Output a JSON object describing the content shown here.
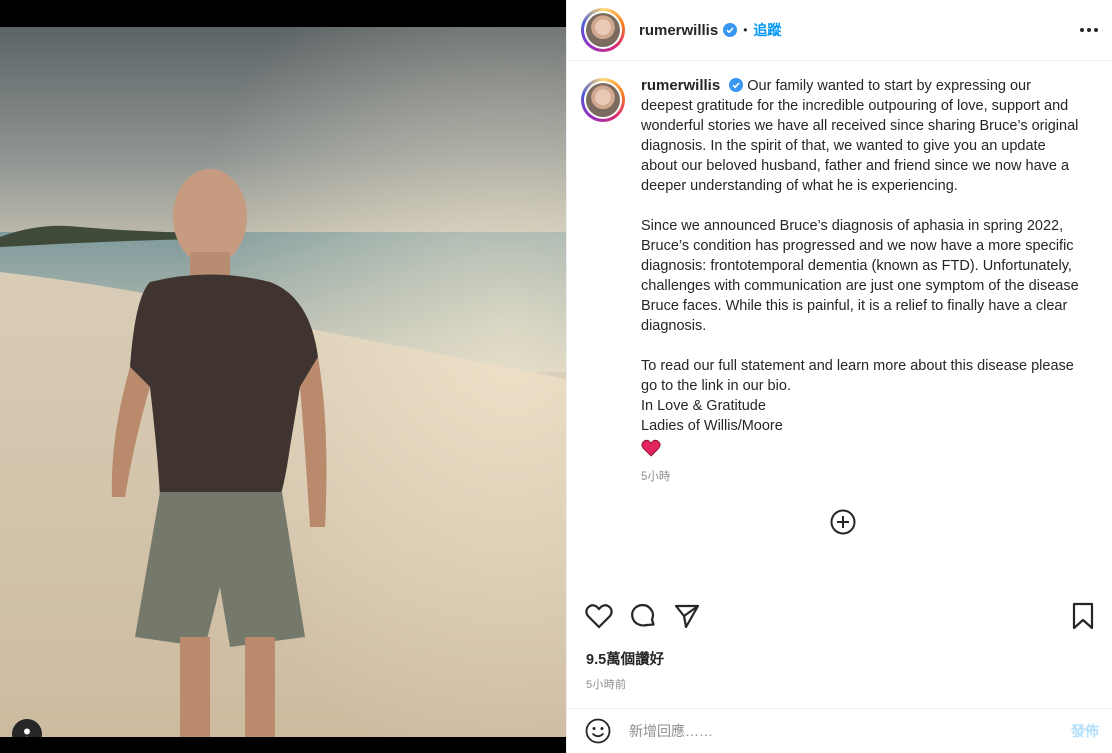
{
  "post": {
    "username": "rumerwillis",
    "follow_label": "追蹤",
    "separator": "•",
    "caption": {
      "username": "rumerwillis",
      "p1": "Our family wanted to start by expressing our deepest gratitude for the incredible outpouring of love, support and wonderful stories we have all received since sharing Bruce’s original diagnosis. In the spirit of that, we wanted to give you an update about our beloved husband, father and friend since we now have a deeper understanding of what he is experiencing.",
      "p2": "Since we announced Bruce’s diagnosis of aphasia in spring 2022, Bruce’s condition has progressed and we now have a more specific diagnosis: frontotemporal dementia (known as FTD). Unfortunately, challenges with communication are just one symptom of the disease Bruce faces. While this is painful, it is a relief to finally have a clear diagnosis.",
      "p3": "To read our full statement and learn more about this disease please go to the link in our bio.",
      "p4": "In Love & Gratitude",
      "p5": "Ladies of Willis/Moore",
      "time": "5小時"
    },
    "likes": "9.5萬個讚好",
    "time_ago": "5小時前",
    "comment": {
      "placeholder": "新增回應……",
      "post_label": "發佈"
    },
    "icons": {
      "verified": "verified-badge-icon",
      "more": "more-options-icon",
      "heart_emoji": "red-heart-icon",
      "load_more": "add-circle-icon",
      "like": "heart-icon",
      "comment": "comment-icon",
      "share": "share-icon",
      "save": "bookmark-icon",
      "emoji": "emoji-icon",
      "tag": "user-tag-icon"
    },
    "colors": {
      "accent": "#0095f6",
      "verified": "#3897f0",
      "heart": "#e0245e",
      "muted": "#8e8e8e",
      "post_disabled": "#b2dffc"
    }
  }
}
